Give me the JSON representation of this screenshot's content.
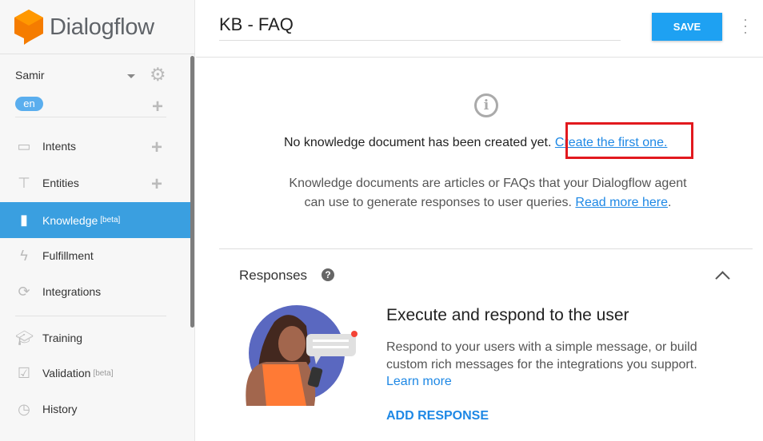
{
  "sidebar": {
    "brand": "Dialogflow",
    "agent": "Samir",
    "language": "en",
    "items": [
      {
        "label": "Intents"
      },
      {
        "label": "Entities"
      },
      {
        "label": "Knowledge",
        "badge": "[beta]"
      },
      {
        "label": "Fulfillment"
      },
      {
        "label": "Integrations"
      },
      {
        "label": "Training"
      },
      {
        "label": "Validation",
        "badge": "[beta]"
      },
      {
        "label": "History"
      }
    ]
  },
  "header": {
    "title": "KB - FAQ",
    "save": "SAVE"
  },
  "empty": {
    "message": "No knowledge document has been created yet.",
    "create_link": "Create the first one.",
    "desc1": "Knowledge documents are articles or FAQs that your Dialogflow agent",
    "desc2": "can use to generate responses to user queries.",
    "read_more": "Read more here",
    "period": "."
  },
  "responses": {
    "title": "Responses",
    "help": "?",
    "heading": "Execute and respond to the user",
    "body": "Respond to your users with a simple message, or build custom rich messages for the integrations you support.",
    "learn_more": "Learn more",
    "add": "ADD RESPONSE"
  },
  "colors": {
    "accent": "#1ea1f2",
    "active": "#3a9fe0",
    "highlight": "#e2191e"
  }
}
